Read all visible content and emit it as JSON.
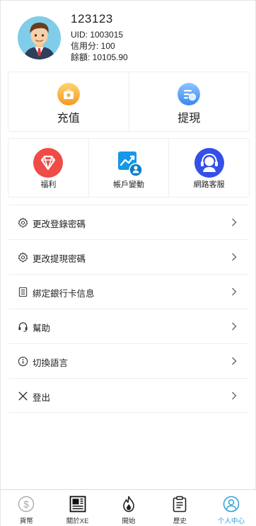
{
  "profile": {
    "username": "123123",
    "uid": "UID: 1003015",
    "credit": "信用分: 100",
    "balance": "餘額: 10105.90"
  },
  "actions": {
    "deposit_label": "充值",
    "withdraw_label": "提現"
  },
  "quick_links": [
    {
      "label": "福利"
    },
    {
      "label": "帳戶變動"
    },
    {
      "label": "網路客服"
    }
  ],
  "menu": [
    {
      "label": "更改登錄密碼",
      "icon": "gear-icon"
    },
    {
      "label": "更改提現密碼",
      "icon": "gear-icon"
    },
    {
      "label": "綁定銀行卡信息",
      "icon": "document-icon"
    },
    {
      "label": "幫助",
      "icon": "headset-icon"
    },
    {
      "label": "切換語言",
      "icon": "info-icon"
    },
    {
      "label": "登出",
      "icon": "close-icon"
    }
  ],
  "tabs": [
    {
      "label": "貨幣",
      "icon": "dollar-icon"
    },
    {
      "label": "關於XE",
      "icon": "newspaper-icon"
    },
    {
      "label": "開始",
      "icon": "flame-icon"
    },
    {
      "label": "歷史",
      "icon": "clipboard-icon"
    },
    {
      "label": "个人中心",
      "icon": "user-icon",
      "active": true
    }
  ],
  "colors": {
    "accent": "#2a9fd6",
    "deposit_icon": "#f7b23b",
    "withdraw_icon": "#4d9ef7",
    "welfare_icon": "#ef4b47",
    "account_icon": "#1598e6",
    "support_icon": "#3350e8"
  }
}
